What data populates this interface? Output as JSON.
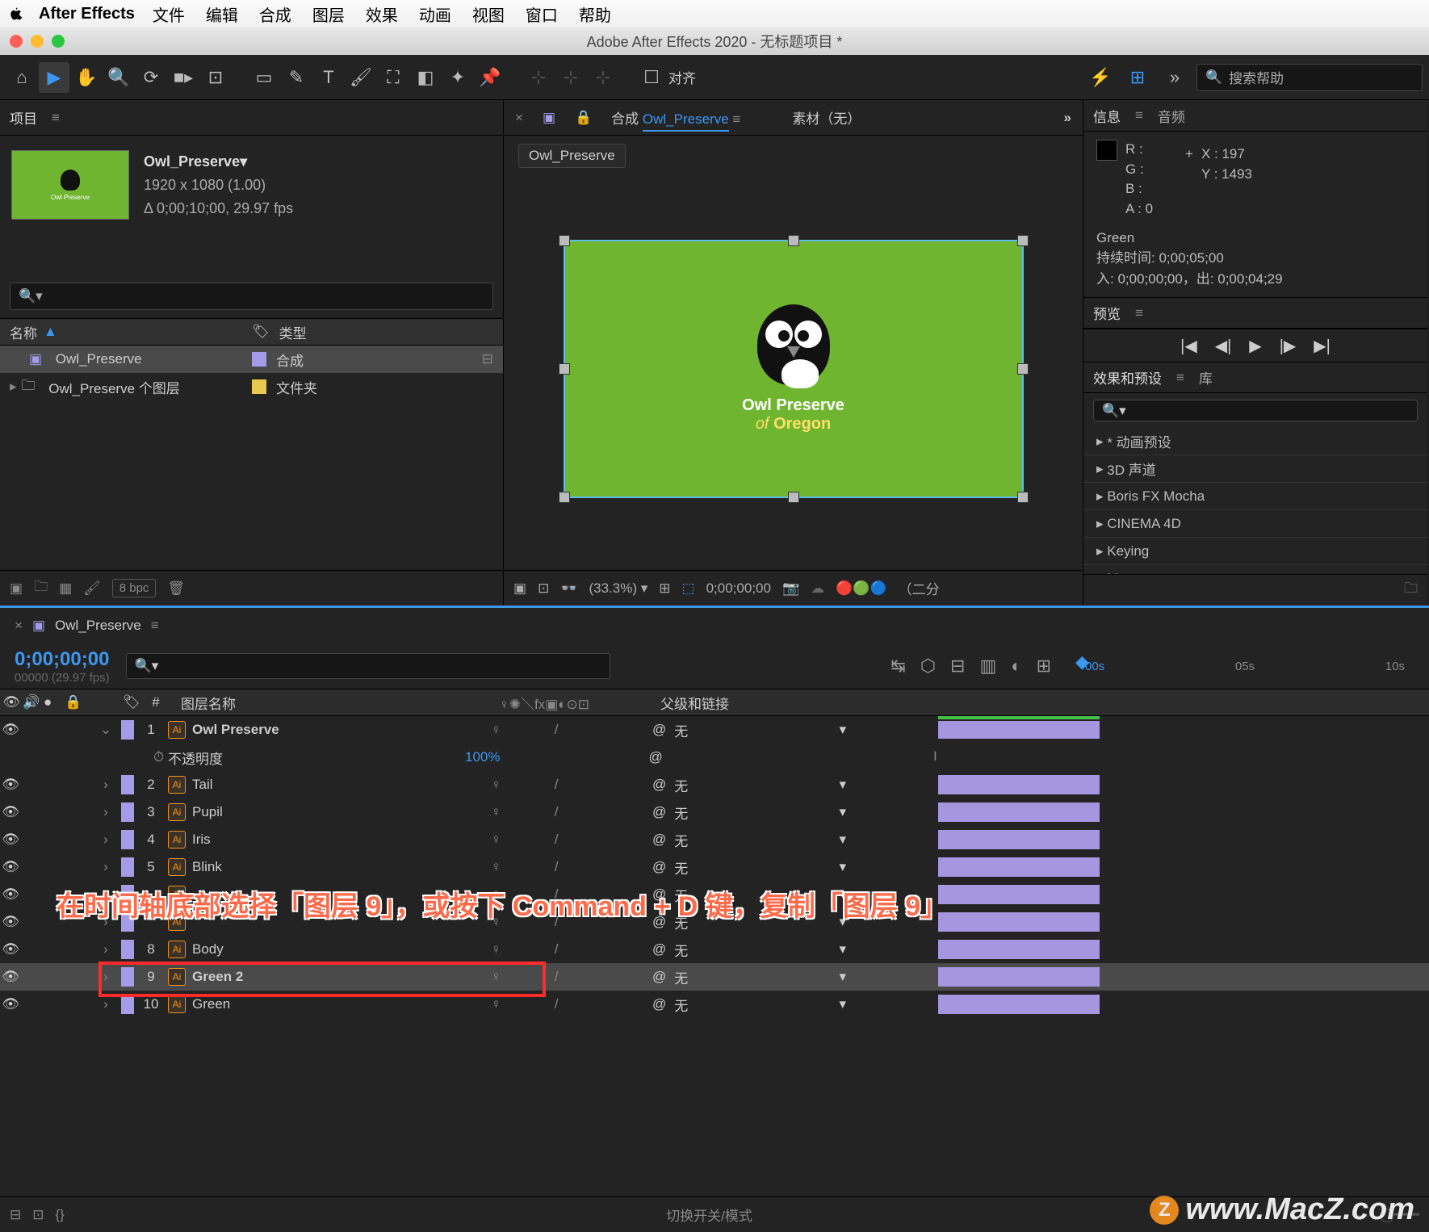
{
  "menubar": {
    "app": "After Effects",
    "items": [
      "文件",
      "编辑",
      "合成",
      "图层",
      "效果",
      "动画",
      "视图",
      "窗口",
      "帮助"
    ]
  },
  "titlebar": {
    "title": "Adobe After Effects 2020 - 无标题项目 *"
  },
  "toolbar": {
    "align_label": "对齐",
    "search_placeholder": "搜索帮助"
  },
  "project": {
    "panel_label": "项目",
    "comp_name": "Owl_Preserve▾",
    "dim": "1920 x 1080 (1.00)",
    "dur": "Δ 0;00;10;00, 29.97 fps",
    "name_col": "名称",
    "type_col": "类型",
    "rows": [
      {
        "name": "Owl_Preserve",
        "type": "合成"
      },
      {
        "name": "Owl_Preserve 个图层",
        "type": "文件夹"
      }
    ],
    "bpc": "8 bpc"
  },
  "comp": {
    "tab_comp": "合成",
    "comp_name": "Owl_Preserve",
    "tab_footage": "素材（无）",
    "breadcrumb": "Owl_Preserve",
    "logo_l1": "Owl Preserve",
    "logo_l2": "of",
    "logo_l3": "Oregon",
    "zoom": "(33.3%)",
    "time": "0;00;00;00",
    "res": "（二分"
  },
  "info": {
    "panel": "信息",
    "audio": "音频",
    "r": "R :",
    "g": "G :",
    "b": "B :",
    "a": "A :  0",
    "x": "X : 197",
    "y": "Y : 1493",
    "name": "Green",
    "dur": "持续时间: 0;00;05;00",
    "inout": "入: 0;00;00;00，出: 0;00;04;29",
    "preview": "预览"
  },
  "effects": {
    "panel": "效果和预设",
    "lib": "库",
    "items": [
      "* 动画预设",
      "3D 声道",
      "Boris FX Mocha",
      "CINEMA 4D",
      "Keying",
      "Matte"
    ]
  },
  "timeline": {
    "comp": "Owl_Preserve",
    "timecode": "0;00;00;00",
    "sub": "00000 (29.97 fps)",
    "num_col": "#",
    "lname_col": "图层名称",
    "parent_col": "父级和链接",
    "switch_hint": "切换开关/模式",
    "ticks": [
      "00s",
      "05s",
      "10s"
    ],
    "opacity_label": "不透明度",
    "opacity_val": "100%",
    "none": "无",
    "layers": [
      {
        "n": "1",
        "name": "Owl Preserve",
        "bold": true
      },
      {
        "n": "2",
        "name": "Tail"
      },
      {
        "n": "3",
        "name": "Pupil"
      },
      {
        "n": "4",
        "name": "Iris"
      },
      {
        "n": "5",
        "name": "Blink"
      },
      {
        "n": "8",
        "name": "Body"
      },
      {
        "n": "9",
        "name": "Green 2",
        "sel": true
      },
      {
        "n": "10",
        "name": "Green"
      }
    ]
  },
  "caption": "在时间轴底部选择「图层 9」，或按下 Command + D 键，复制「图层 9」",
  "watermark": "www.MacZ.com"
}
